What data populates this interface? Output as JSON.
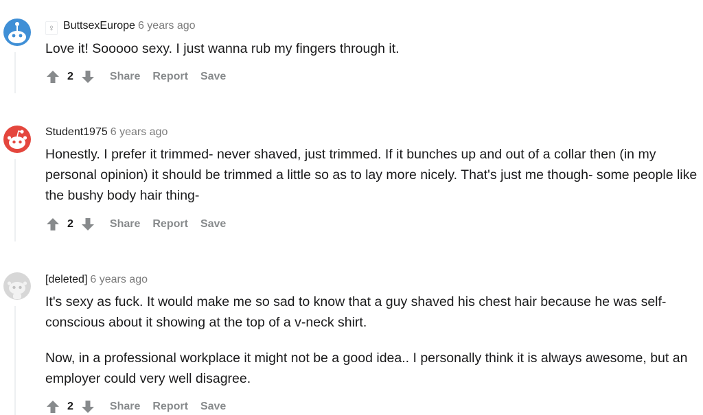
{
  "comments": [
    {
      "author": "ButtsexEurope",
      "age": "6 years ago",
      "flair_icon": "female-symbol-icon",
      "paragraphs": [
        "Love it! Sooooo sexy. I just wanna rub my fingers through it."
      ],
      "score": "2",
      "avatar": "reddit-snoo-blue-avatar",
      "avatar_color": "#3f8fd6"
    },
    {
      "author": "Student1975",
      "age": "6 years ago",
      "paragraphs": [
        "Honestly. I prefer it trimmed- never shaved, just trimmed. If it bunches up and out of a collar then (in my personal opinion) it should be trimmed a little so as to lay more nicely. That's just me though- some people like the bushy body hair thing-"
      ],
      "score": "2",
      "avatar": "reddit-snoo-red-avatar",
      "avatar_color": "#e4463d"
    },
    {
      "author": "[deleted]",
      "age": "6 years ago",
      "paragraphs": [
        "It's sexy as fuck. It would make me so sad to know that a guy shaved his chest hair because he was self-conscious about it showing at the top of a v-neck shirt.",
        "Now, in a professional workplace it might not be a good idea.. I personally think it is always awesome, but an employer could very well disagree."
      ],
      "score": "2",
      "avatar": "reddit-snoo-gray-avatar",
      "avatar_color": "#d7d7d7"
    }
  ],
  "actions": {
    "share": "Share",
    "report": "Report",
    "save": "Save"
  },
  "colors": {
    "meta_text": "#7c7c7c",
    "action_text": "#878a8c",
    "vote_arrow": "#878a8c",
    "thread_line": "#edeff1"
  },
  "icons": {
    "upvote": "arrow-up-icon",
    "downvote": "arrow-down-icon"
  }
}
